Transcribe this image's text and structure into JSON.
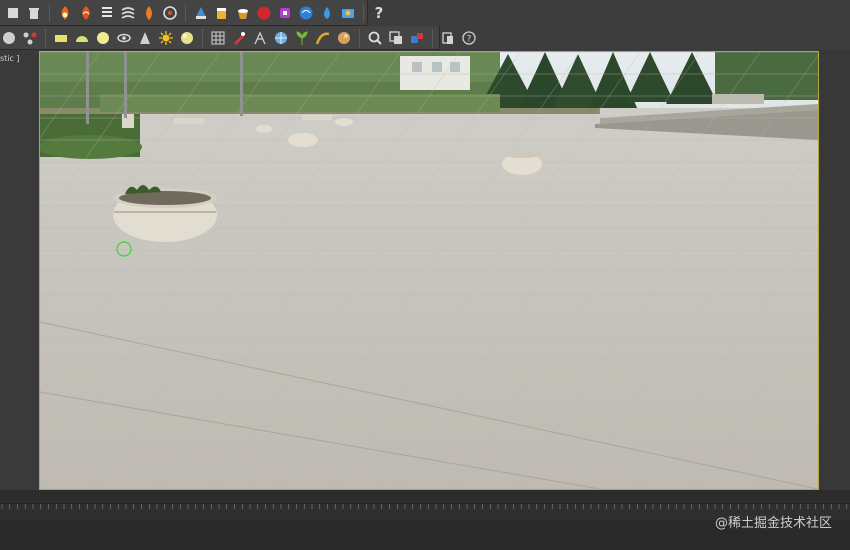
{
  "window": {
    "viewport_label": "stic ]"
  },
  "toolbar_main": [
    {
      "name": "select-box-icon",
      "color": "#d9d9d9"
    },
    {
      "name": "trash-icon",
      "color": "#d9d9d9"
    },
    {
      "name": "fire-icon",
      "color": "#e86a1e"
    },
    {
      "name": "fire-swirl-icon",
      "color": "#e0551b"
    },
    {
      "name": "spring-icon",
      "color": "#e6e6e6"
    },
    {
      "name": "wind-icon",
      "color": "#d8d8d8"
    },
    {
      "name": "flame-icon",
      "color": "#f07a21"
    },
    {
      "name": "swirl-icon",
      "color": "#dcdcdc"
    },
    {
      "name": "fluid-icon",
      "color": "#3f8fd6"
    },
    {
      "name": "cup-icon",
      "color": "#f0b030"
    },
    {
      "name": "bucket-icon",
      "color": "#d99a2b"
    },
    {
      "name": "red-ball-icon",
      "color": "#d4262a"
    },
    {
      "name": "purple-cube-icon",
      "color": "#b03fd0"
    },
    {
      "name": "blue-orb-icon",
      "color": "#2f7fd8"
    },
    {
      "name": "water-drop-icon",
      "color": "#3b9ae0"
    },
    {
      "name": "render-icon",
      "color": "#49a3e6"
    }
  ],
  "toolbar_help": {
    "label": "?"
  },
  "toolbar_secondary": [
    {
      "name": "circle-half-icon",
      "color": "#cfcfcf"
    },
    {
      "name": "nodes-icon",
      "color": "#d0d0d0"
    },
    {
      "name": "rectangle-light-icon",
      "color": "#e8e06a"
    },
    {
      "name": "dome-light-icon",
      "color": "#d8e07a"
    },
    {
      "name": "sphere-light-icon",
      "color": "#f0ec90"
    },
    {
      "name": "eye-icon",
      "color": "#d6d6d6"
    },
    {
      "name": "cone-light-icon",
      "color": "#d0d0d0"
    },
    {
      "name": "sun-icon",
      "color": "#f2c21e"
    },
    {
      "name": "sphere-icon",
      "color": "#e8e08a"
    },
    {
      "name": "grid-mesh-icon",
      "color": "#cfcfcf"
    },
    {
      "name": "brush-icon",
      "color": "#d23a3a"
    },
    {
      "name": "hair-icon",
      "color": "#d0d0d0"
    },
    {
      "name": "globe-icon",
      "color": "#6fb0e6"
    },
    {
      "name": "plant-icon",
      "color": "#78b83a"
    },
    {
      "name": "fur-icon",
      "color": "#e0a832"
    },
    {
      "name": "material-ball-icon",
      "color": "#d9a05a"
    },
    {
      "name": "magnifier-icon",
      "color": "#dcdcdc"
    },
    {
      "name": "frame-buffer-icon",
      "color": "#d6d6d6"
    },
    {
      "name": "cubes-icon",
      "color": "#3f7ad0"
    },
    {
      "name": "layers-icon",
      "color": "#d4d4d4"
    },
    {
      "name": "help-circle-icon",
      "color": "#cfcfcf"
    }
  ],
  "timeline": {
    "ticks": [
      "0",
      "60",
      "80",
      "100",
      "120",
      "140",
      "160",
      "180",
      "200",
      "220",
      "240",
      "260",
      "280",
      "300",
      "320",
      "340",
      "360",
      "380",
      "400",
      "420",
      "440",
      "460",
      "480",
      "500",
      "520",
      "540",
      "560",
      "580"
    ]
  },
  "watermark": "@稀土掘金技术社区"
}
